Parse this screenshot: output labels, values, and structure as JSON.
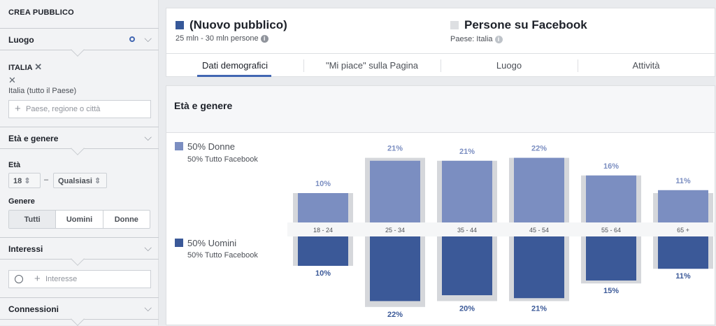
{
  "sidebar": {
    "title": "CREA PUBBLICO",
    "location_label": "Luogo",
    "country_tag": "ITALIA",
    "country_detail": "Italia (tutto il Paese)",
    "location_placeholder": "Paese, regione o città",
    "age_gender_label": "Età e genere",
    "age_label": "Età",
    "age_min": "18",
    "age_separator": "–",
    "age_max": "Qualsiasi",
    "gender_label": "Genere",
    "gender_options": [
      "Tutti",
      "Uomini",
      "Donne"
    ],
    "interests_label": "Interessi",
    "interests_placeholder": "Interesse",
    "connections_label": "Connessioni"
  },
  "header": {
    "audience_title": "(Nuovo pubblico)",
    "audience_size": "25 mln - 30 mln persone",
    "facebook_title": "Persone su Facebook",
    "facebook_country": "Paese: Italia",
    "audience_color": "#365899",
    "facebook_color": "#dddfe2"
  },
  "tabs": [
    "Dati demografici",
    "\"Mi piace\" sulla Pagina",
    "Luogo",
    "Attività"
  ],
  "panel": {
    "title": "Età e genere",
    "women_legend": "50% Donne",
    "women_sub": "50% Tutto Facebook",
    "men_legend": "50% Uomini",
    "men_sub": "50% Tutto Facebook"
  },
  "colors": {
    "women": "#7b8ec1",
    "men": "#3b5998",
    "background_bar": "#d5d7db",
    "accent": "#4267b2"
  },
  "chart_data": {
    "type": "bar",
    "categories": [
      "18 - 24",
      "25 - 34",
      "35 - 44",
      "45 - 54",
      "55 - 64",
      "65 +"
    ],
    "series": [
      {
        "name": "Donne",
        "values": [
          10,
          21,
          21,
          22,
          16,
          11
        ],
        "labels": [
          "10%",
          "21%",
          "21%",
          "22%",
          "16%",
          "11%"
        ],
        "baseline": [
          10,
          22,
          21,
          22,
          16,
          10
        ]
      },
      {
        "name": "Uomini",
        "values": [
          10,
          22,
          20,
          21,
          15,
          11
        ],
        "labels": [
          "10%",
          "22%",
          "20%",
          "21%",
          "15%",
          "11%"
        ],
        "baseline": [
          10,
          24,
          22,
          22,
          16,
          11
        ]
      }
    ]
  }
}
